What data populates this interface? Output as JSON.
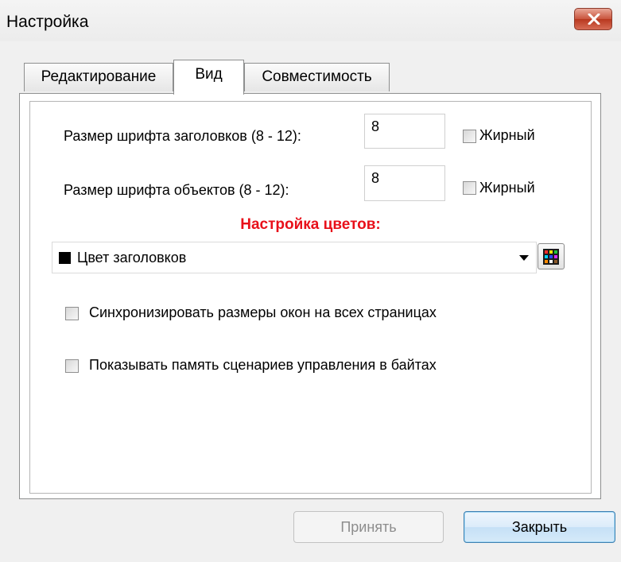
{
  "window": {
    "title": "Настройка"
  },
  "tabs": [
    {
      "label": "Редактирование",
      "active": false
    },
    {
      "label": "Вид",
      "active": true
    },
    {
      "label": "Совместимость",
      "active": false
    }
  ],
  "view": {
    "header_font": {
      "label": "Размер шрифта заголовков (8 - 12):",
      "value": "8",
      "bold_label": "Жирный",
      "bold_checked": false
    },
    "object_font": {
      "label": "Размер шрифта объектов (8 - 12):",
      "value": "8",
      "bold_label": "Жирный",
      "bold_checked": false
    },
    "colors": {
      "title": "Настройка цветов:",
      "title_color": "#e8101a",
      "selected_option": "Цвет заголовков",
      "selected_color": "#000000",
      "palette_icon": "color-palette-icon"
    },
    "options": [
      {
        "label": "Синхронизировать размеры окон на всех страницах",
        "checked": false
      },
      {
        "label": "Показывать память сценариев управления в байтах",
        "checked": false
      }
    ]
  },
  "buttons": {
    "apply": {
      "label": "Принять",
      "enabled": false
    },
    "close": {
      "label": "Закрыть",
      "enabled": true
    }
  }
}
